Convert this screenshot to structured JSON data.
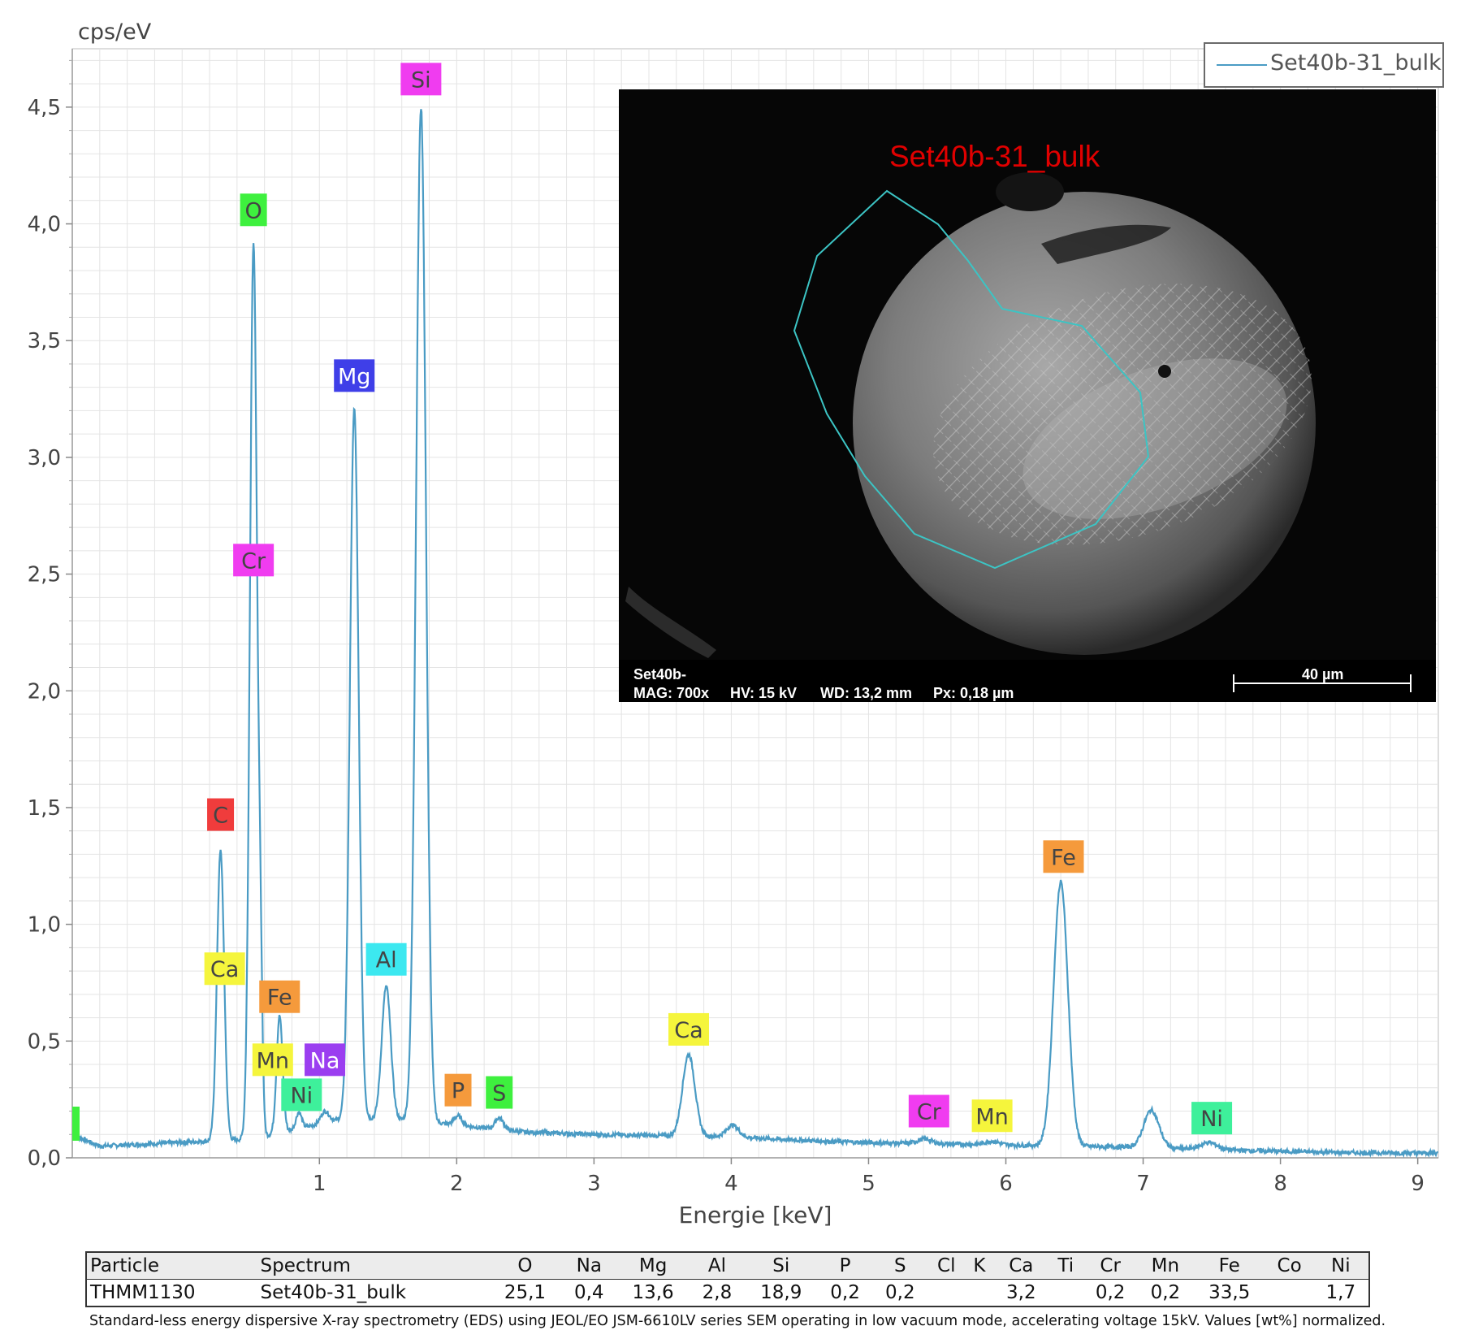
{
  "chart_data": {
    "type": "line",
    "title": "",
    "ylabel": "cps/eV",
    "xlabel": "Energie [keV]",
    "xlim": [
      -0.8,
      9.15
    ],
    "ylim": [
      0,
      4.75
    ],
    "x_ticks": [
      "1",
      "2",
      "3",
      "4",
      "5",
      "6",
      "7",
      "8",
      "9"
    ],
    "y_ticks": [
      "0,0",
      "0,5",
      "1,0",
      "1,5",
      "2,0",
      "2,5",
      "3,0",
      "3,5",
      "4,0",
      "4,5"
    ],
    "grid": true,
    "legend_position": "top-right",
    "series": [
      {
        "name": "Set40b-31_bulk",
        "color": "#4a9bc4",
        "baseline": [
          [
            -0.8,
            0.1
          ],
          [
            -0.6,
            0.05
          ],
          [
            0.5,
            0.08
          ],
          [
            0.8,
            0.12
          ],
          [
            1.2,
            0.17
          ],
          [
            1.7,
            0.16
          ],
          [
            2.0,
            0.14
          ],
          [
            2.5,
            0.11
          ],
          [
            3.0,
            0.1
          ],
          [
            3.5,
            0.095
          ],
          [
            4.0,
            0.09
          ],
          [
            4.5,
            0.075
          ],
          [
            5.0,
            0.065
          ],
          [
            5.5,
            0.06
          ],
          [
            6.0,
            0.055
          ],
          [
            6.5,
            0.05
          ],
          [
            7.0,
            0.045
          ],
          [
            7.5,
            0.035
          ],
          [
            8.0,
            0.028
          ],
          [
            8.5,
            0.022
          ],
          [
            9.15,
            0.02
          ]
        ],
        "peaks": [
          {
            "center": 0.28,
            "height": 1.24,
            "width": 0.026
          },
          {
            "center": 0.52,
            "height": 3.84,
            "width": 0.026
          },
          {
            "center": 0.57,
            "height": 0.6,
            "width": 0.015
          },
          {
            "center": 0.71,
            "height": 0.5,
            "width": 0.022
          },
          {
            "center": 0.85,
            "height": 0.07,
            "width": 0.02
          },
          {
            "center": 1.04,
            "height": 0.05,
            "width": 0.03
          },
          {
            "center": 1.254,
            "height": 3.04,
            "width": 0.032
          },
          {
            "center": 1.487,
            "height": 0.57,
            "width": 0.033
          },
          {
            "center": 1.74,
            "height": 4.34,
            "width": 0.036
          },
          {
            "center": 2.01,
            "height": 0.04,
            "width": 0.03
          },
          {
            "center": 2.31,
            "height": 0.05,
            "width": 0.03
          },
          {
            "center": 3.69,
            "height": 0.35,
            "width": 0.045
          },
          {
            "center": 4.01,
            "height": 0.05,
            "width": 0.045
          },
          {
            "center": 5.41,
            "height": 0.02,
            "width": 0.05
          },
          {
            "center": 5.9,
            "height": 0.015,
            "width": 0.05
          },
          {
            "center": 6.4,
            "height": 1.13,
            "width": 0.052
          },
          {
            "center": 7.06,
            "height": 0.16,
            "width": 0.055
          },
          {
            "center": 7.48,
            "height": 0.03,
            "width": 0.06
          }
        ]
      }
    ],
    "element_markers": [
      {
        "label": "Si",
        "x": 1.74,
        "y": 4.62,
        "color": "#f03cf0"
      },
      {
        "label": "O",
        "x": 0.52,
        "y": 4.06,
        "color": "#3ef03e"
      },
      {
        "label": "Mg",
        "x": 1.254,
        "y": 3.35,
        "color": "#3f3fe8"
      },
      {
        "label": "Cr",
        "x": 0.52,
        "y": 2.56,
        "color": "#f03cf0"
      },
      {
        "label": "C",
        "x": 0.28,
        "y": 1.47,
        "color": "#f03c3c"
      },
      {
        "label": "Ca",
        "x": 0.31,
        "y": 0.81,
        "color": "#f5f53c"
      },
      {
        "label": "Fe",
        "x": 0.71,
        "y": 0.69,
        "color": "#f59a3c"
      },
      {
        "label": "Al",
        "x": 1.487,
        "y": 0.85,
        "color": "#3ce8f0"
      },
      {
        "label": "Mn",
        "x": 0.66,
        "y": 0.42,
        "color": "#f5f53c"
      },
      {
        "label": "Na",
        "x": 1.04,
        "y": 0.42,
        "color": "#9b3ef0"
      },
      {
        "label": "Ni",
        "x": 0.87,
        "y": 0.27,
        "color": "#3ef09b"
      },
      {
        "label": "P",
        "x": 2.01,
        "y": 0.29,
        "color": "#f59a3c"
      },
      {
        "label": "S",
        "x": 2.31,
        "y": 0.28,
        "color": "#3ef03e"
      },
      {
        "label": "Ca",
        "x": 3.69,
        "y": 0.55,
        "color": "#f5f53c"
      },
      {
        "label": "Cr",
        "x": 5.44,
        "y": 0.2,
        "color": "#f03cf0"
      },
      {
        "label": "Mn",
        "x": 5.9,
        "y": 0.18,
        "color": "#f5f53c"
      },
      {
        "label": "Fe",
        "x": 6.42,
        "y": 1.29,
        "color": "#f59a3c"
      },
      {
        "label": "Ni",
        "x": 7.5,
        "y": 0.17,
        "color": "#3ef09b"
      }
    ]
  },
  "sem_image": {
    "sample_name": "Set40b-31_bulk",
    "caption_line1": "Set40b-",
    "mag": "MAG: 700x",
    "hv": "HV: 15 kV",
    "wd": "WD: 13,2 mm",
    "px": "Px: 0,18 µm",
    "scale_bar": "40 µm",
    "outline_color": "#3cc4c4"
  },
  "table": {
    "headers": [
      "Particle",
      "Spectrum",
      "O",
      "Na",
      "Mg",
      "Al",
      "Si",
      "P",
      "S",
      "Cl",
      "K",
      "Ca",
      "Ti",
      "Cr",
      "Mn",
      "Fe",
      "Co",
      "Ni"
    ],
    "rows": [
      [
        "THMM1130",
        "Set40b-31_bulk",
        "25,1",
        "0,4",
        "13,6",
        "2,8",
        "18,9",
        "0,2",
        "0,2",
        "",
        "",
        "3,2",
        "",
        "0,2",
        "0,2",
        "33,5",
        "",
        "1,7"
      ]
    ]
  },
  "footnote": "Standard-less energy dispersive X-ray spectrometry (EDS) using JEOL/EO JSM-6610LV series SEM operating in low vacuum mode, accelerating voltage 15kV. Values [wt%] normalized."
}
